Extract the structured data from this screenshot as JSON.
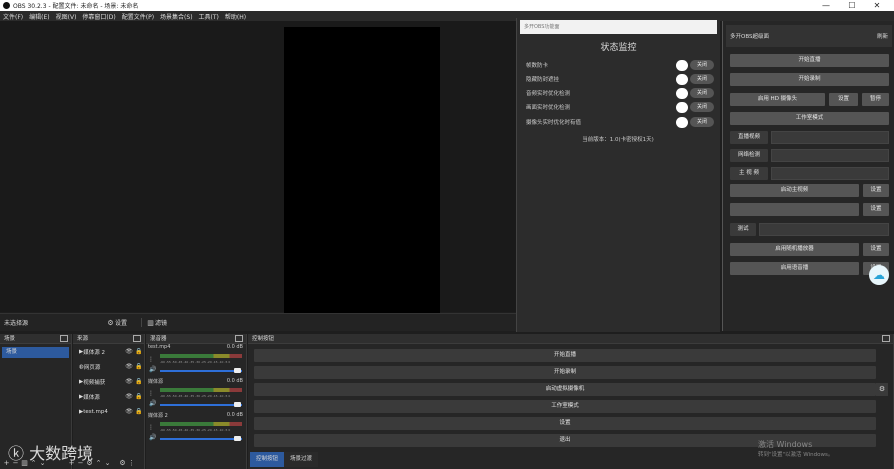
{
  "title": "OBS 30.2.3 - 配置文件: 未命名 - 场景: 未命名",
  "window_controls": {
    "minimize": "—",
    "maximize": "☐",
    "close": "✕"
  },
  "menu": [
    "文件(F)",
    "编辑(E)",
    "视图(V)",
    "停靠窗口(D)",
    "配置文件(P)",
    "场景集合(S)",
    "工具(T)",
    "帮助(H)"
  ],
  "source_bar": {
    "no_source": "未选择源",
    "settings_label": "设置",
    "filters_label": "滤镜"
  },
  "monitor": {
    "header": "多开OBS功能面",
    "title": "状态监控",
    "rows": [
      {
        "label": "帧数防卡",
        "btn": "关闭"
      },
      {
        "label": "隐藏防封遮挂",
        "btn": "关闭"
      },
      {
        "label": "音频实时优化检测",
        "btn": "关闭"
      },
      {
        "label": "画面实时优化检测",
        "btn": "关闭"
      },
      {
        "label": "摄像头实时优化时有值",
        "btn": "关闭"
      }
    ],
    "version": "当前版本：1.0(卡密授权1天)"
  },
  "right_panel": {
    "header_left": "多开OBS超级面",
    "header_right": "刷新",
    "btn_start_stream": "开始直播",
    "btn_start_record": "开始录制",
    "btn_virtual_cam": "启用 HD 摄像头",
    "btn_settings": "设置",
    "btn_stop": "暂停",
    "btn_studio": "工作室模式",
    "label_live_video": "直播视频",
    "label_network": "网络检测",
    "label_main_video": "主 视 频",
    "btn_auto_video": "启动主视频",
    "btn_auto_video_settings": "设置",
    "btn_red_set": "设置",
    "label_test": "测试",
    "btn_voice_cam": "启用随机播放器",
    "btn_voice_settings": "设置",
    "btn_auto_audio": "启用语音播",
    "btn_auto_audio_settings": "设置"
  },
  "docks": {
    "scenes": {
      "title": "场景",
      "items": [
        "场景"
      ]
    },
    "sources": {
      "title": "来源",
      "items": [
        "媒体源 2",
        "网页源",
        "视频捕获",
        "媒体源",
        "test.mp4"
      ]
    },
    "mixer": {
      "title": "混音器",
      "tracks": [
        {
          "name": "test.mp4",
          "db": "0.0 dB",
          "level": 0.95
        },
        {
          "name": "媒体源",
          "db": "0.0 dB",
          "level": 0.95
        },
        {
          "name": "媒体源 2",
          "db": "0.0 dB",
          "level": 0.95
        }
      ],
      "scale": "-60 -55 -50 -45 -40 -35 -30 -25 -20 -15 -10 -5 0"
    },
    "controls": {
      "title": "控制按钮",
      "buttons": [
        "开始直播",
        "开始录制",
        "启动虚拟摄像机",
        "工作室模式",
        "设置",
        "退出"
      ]
    }
  },
  "control_tabs": [
    "控制按钮",
    "场景过渡"
  ],
  "watermark_left": "大数跨境",
  "watermark_right": {
    "line1": "激活 Windows",
    "line2": "转到\"设置\"以激活 Windows。"
  }
}
